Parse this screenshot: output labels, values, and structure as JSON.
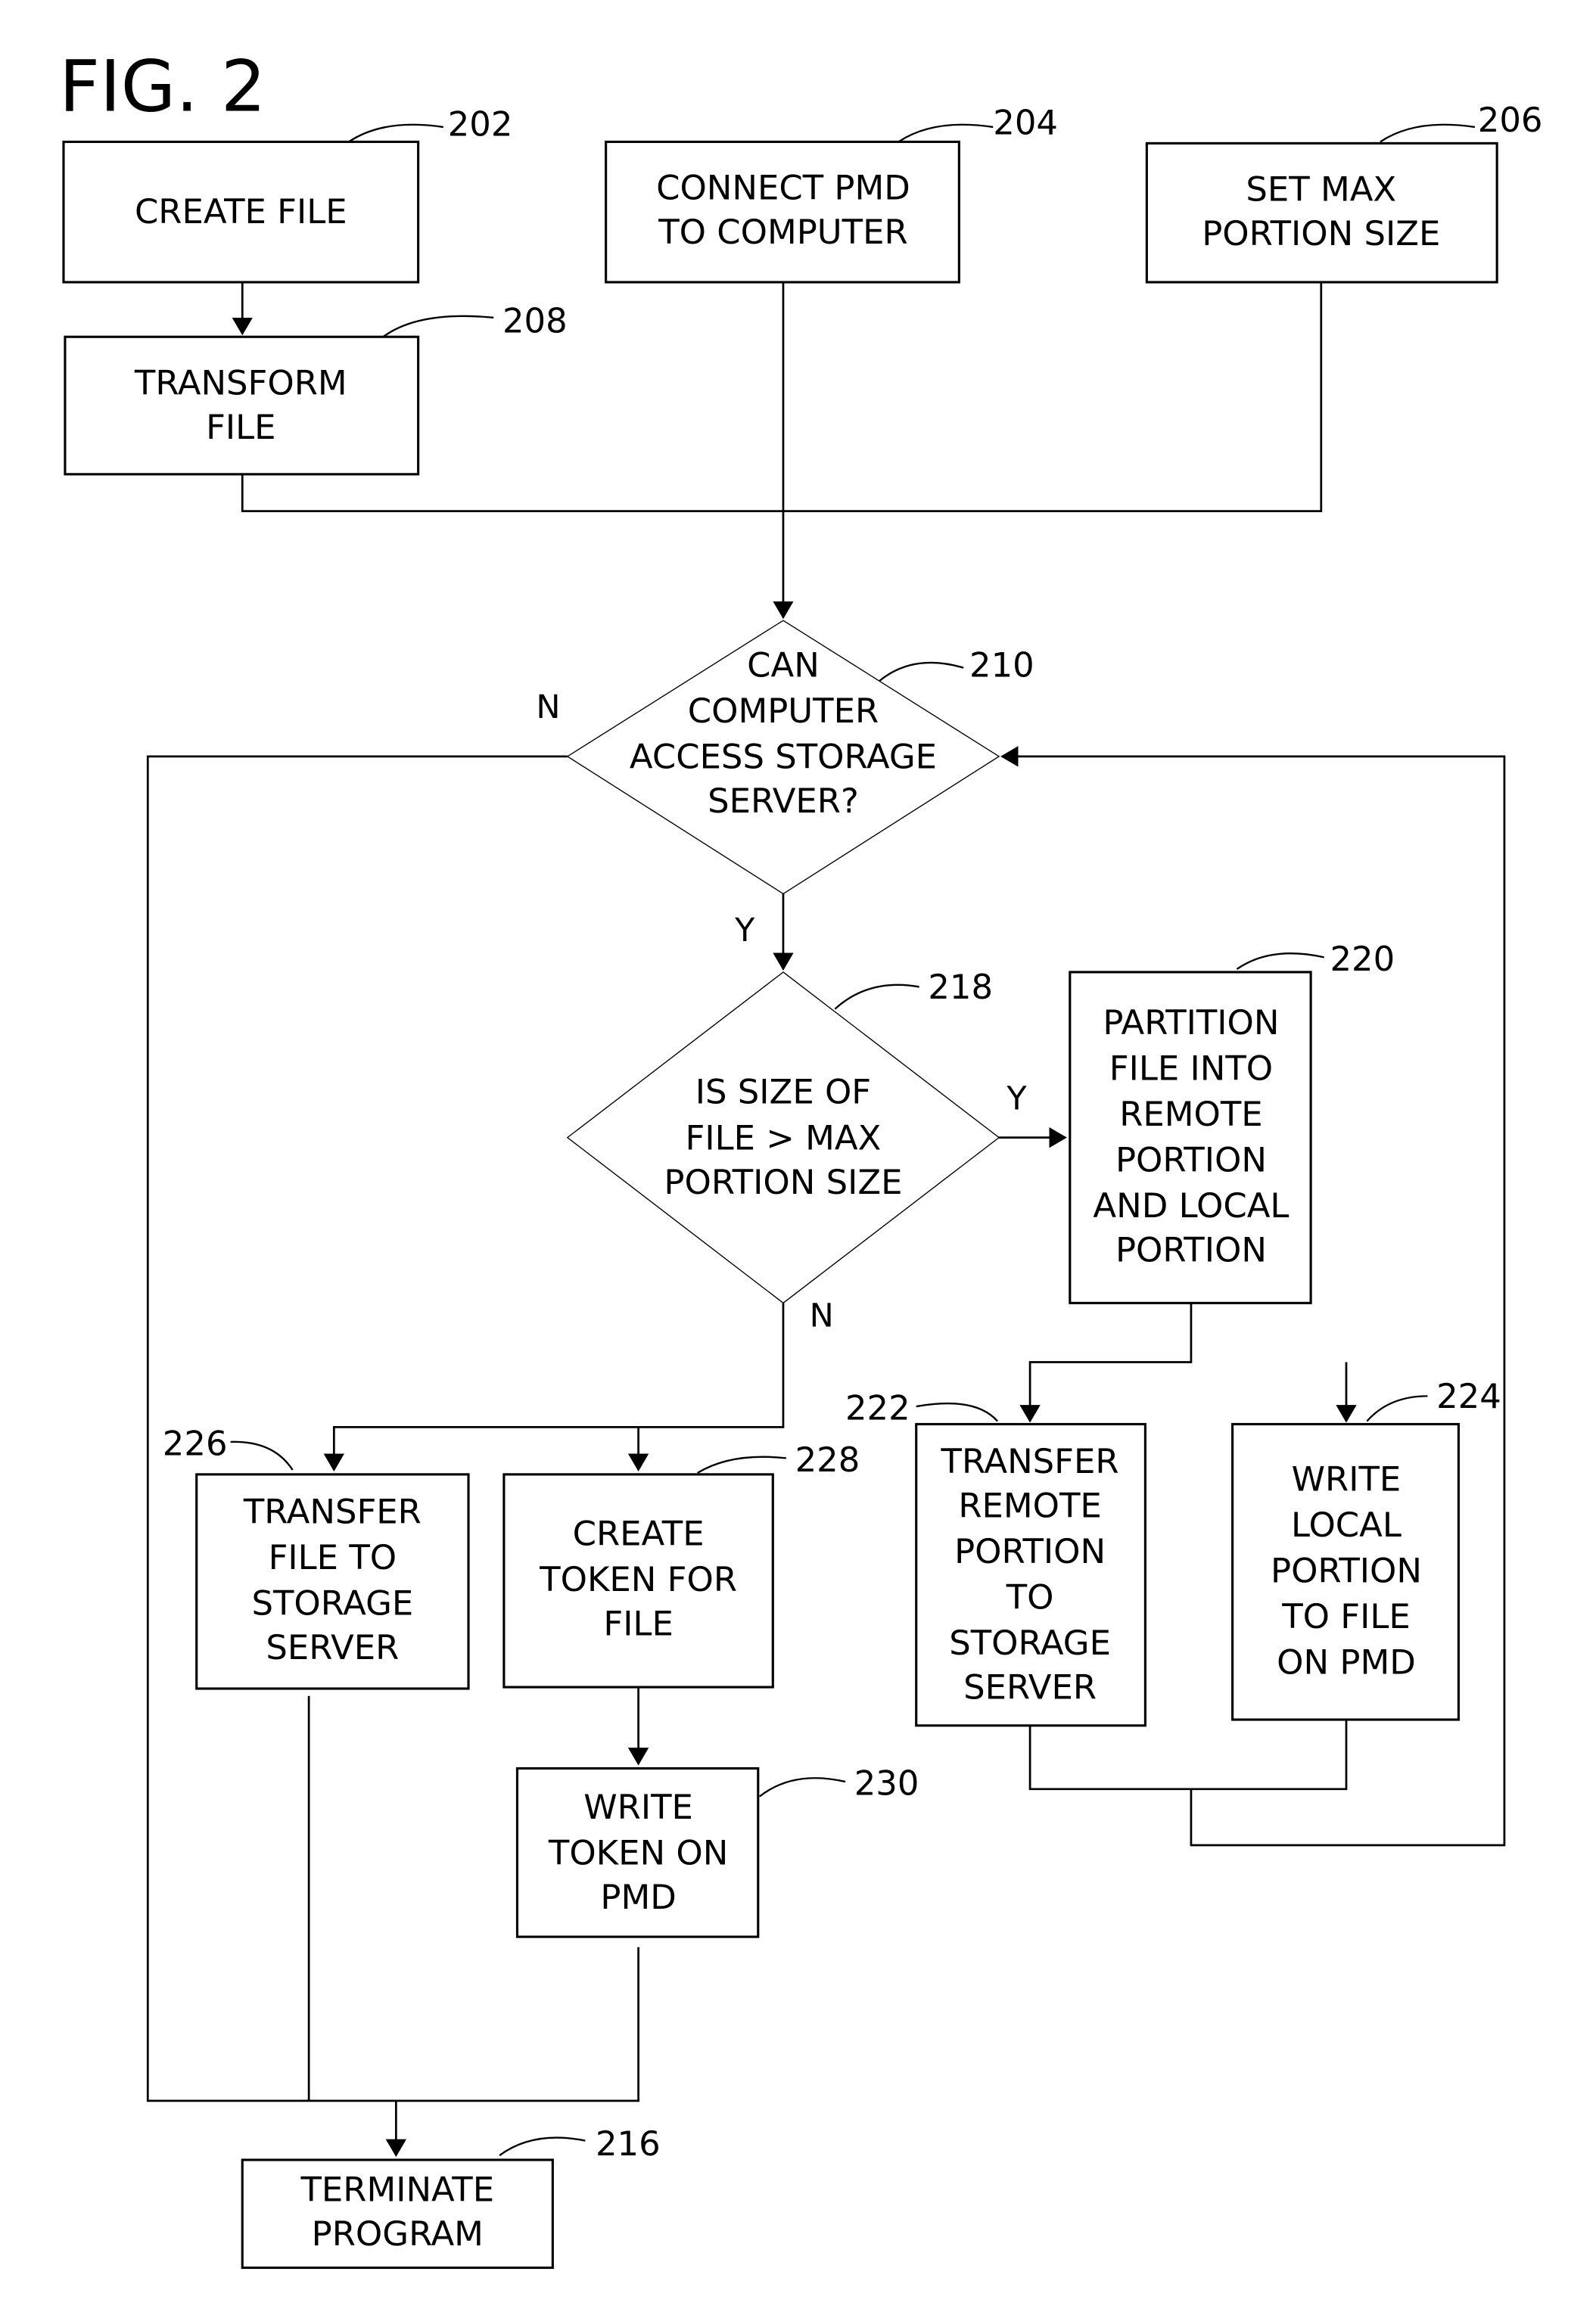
{
  "figure": {
    "title": "FIG. 2"
  },
  "nodes": {
    "n202": {
      "ref": "202",
      "lines": [
        "CREATE FILE"
      ]
    },
    "n204": {
      "ref": "204",
      "lines": [
        "CONNECT PMD",
        "TO COMPUTER"
      ]
    },
    "n206": {
      "ref": "206",
      "lines": [
        "SET MAX",
        "PORTION SIZE"
      ]
    },
    "n208": {
      "ref": "208",
      "lines": [
        "TRANSFORM",
        "FILE"
      ]
    },
    "n210": {
      "ref": "210",
      "lines": [
        "CAN",
        "COMPUTER",
        "ACCESS STORAGE",
        "SERVER?"
      ]
    },
    "n218": {
      "ref": "218",
      "lines": [
        "IS SIZE OF",
        "FILE > MAX",
        "PORTION SIZE"
      ]
    },
    "n220": {
      "ref": "220",
      "lines": [
        "PARTITION",
        "FILE INTO",
        "REMOTE",
        "PORTION",
        "AND LOCAL",
        "PORTION"
      ]
    },
    "n222": {
      "ref": "222",
      "lines": [
        "TRANSFER",
        "REMOTE",
        "PORTION",
        "TO",
        "STORAGE",
        "SERVER"
      ]
    },
    "n224": {
      "ref": "224",
      "lines": [
        "WRITE",
        "LOCAL",
        "PORTION",
        "TO FILE",
        "ON PMD"
      ]
    },
    "n226": {
      "ref": "226",
      "lines": [
        "TRANSFER",
        "FILE TO",
        "STORAGE",
        "SERVER"
      ]
    },
    "n228": {
      "ref": "228",
      "lines": [
        "CREATE",
        "TOKEN FOR",
        "FILE"
      ]
    },
    "n230": {
      "ref": "230",
      "lines": [
        "WRITE",
        "TOKEN ON",
        "PMD"
      ]
    },
    "n216": {
      "ref": "216",
      "lines": [
        "TERMINATE",
        "PROGRAM"
      ]
    }
  },
  "edge_labels": {
    "d210_no": "N",
    "d210_yes": "Y",
    "d218_yes": "Y",
    "d218_no": "N"
  }
}
